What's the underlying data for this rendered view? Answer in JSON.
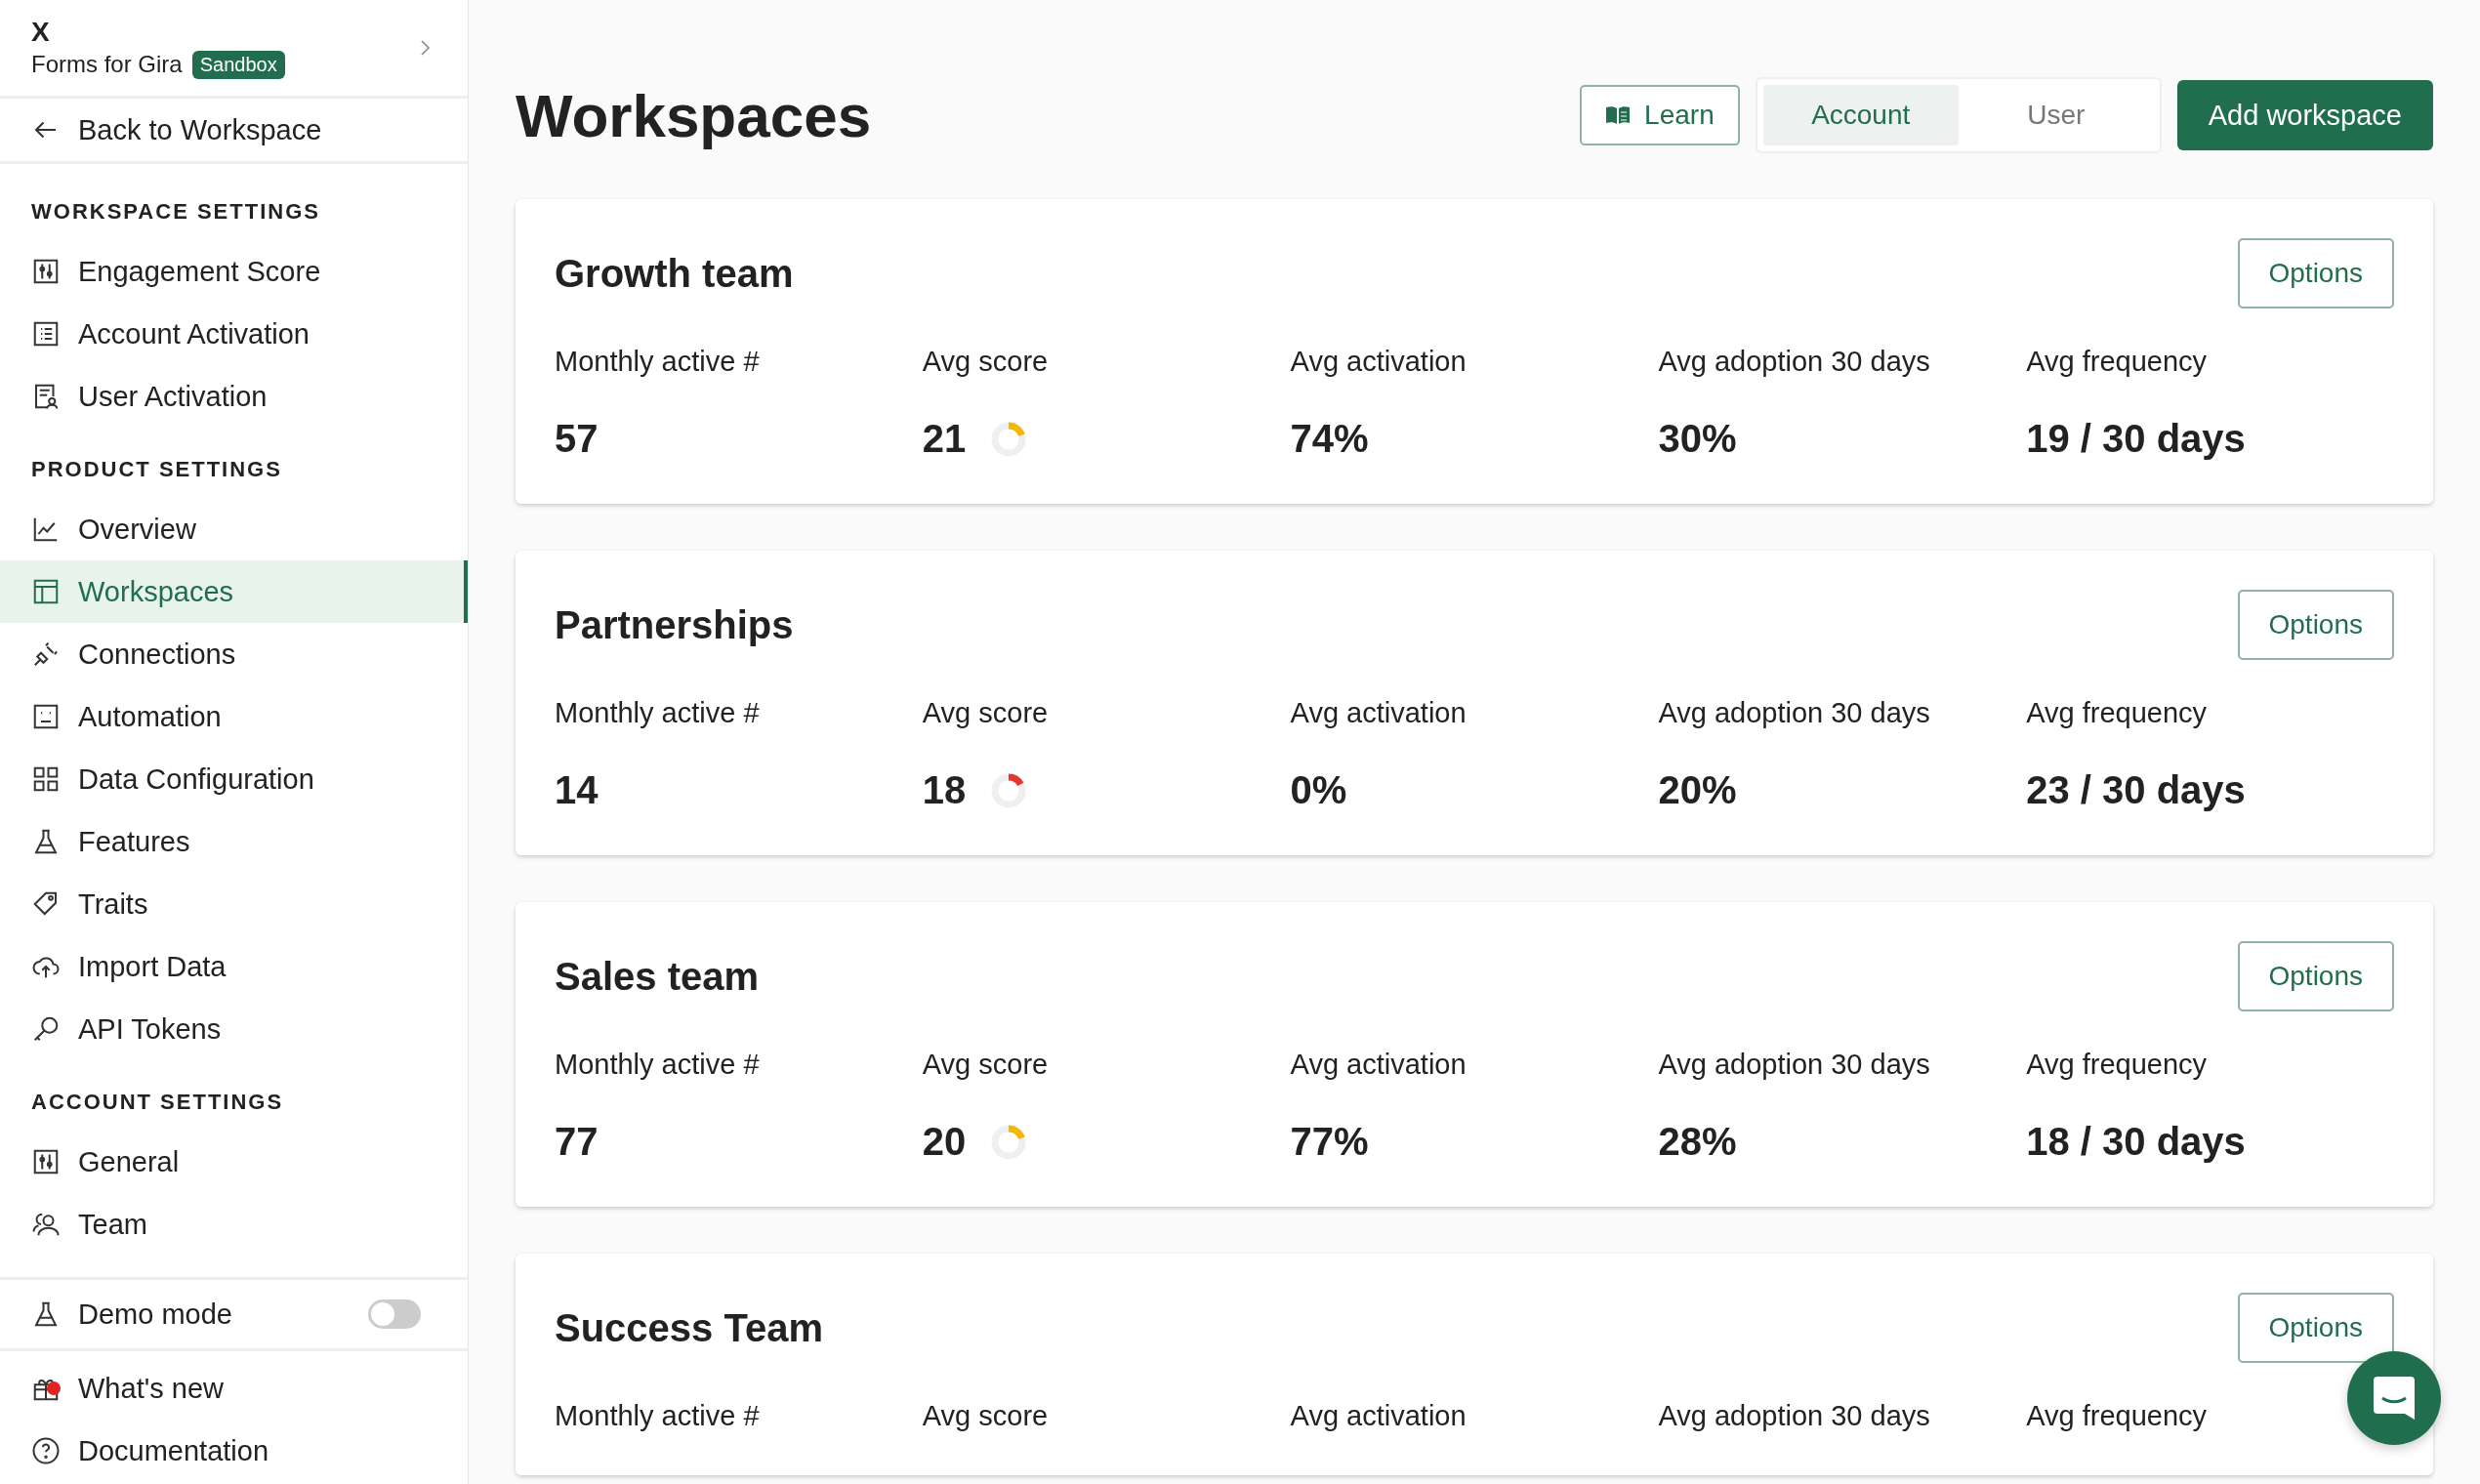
{
  "sidebar": {
    "brand": "X",
    "product": "Forms for Gira",
    "env_badge": "Sandbox",
    "back_link": "Back to Workspace",
    "sections": [
      {
        "heading": "WORKSPACE SETTINGS",
        "items": [
          {
            "label": "Engagement Score",
            "selected": false
          },
          {
            "label": "Account Activation",
            "selected": false
          },
          {
            "label": "User Activation",
            "selected": false
          }
        ]
      },
      {
        "heading": "PRODUCT SETTINGS",
        "items": [
          {
            "label": "Overview",
            "selected": false
          },
          {
            "label": "Workspaces",
            "selected": true
          },
          {
            "label": "Connections",
            "selected": false
          },
          {
            "label": "Automation",
            "selected": false
          },
          {
            "label": "Data Configuration",
            "selected": false
          },
          {
            "label": "Features",
            "selected": false
          },
          {
            "label": "Traits",
            "selected": false
          },
          {
            "label": "Import Data",
            "selected": false
          },
          {
            "label": "API Tokens",
            "selected": false
          }
        ]
      },
      {
        "heading": "ACCOUNT SETTINGS",
        "items": [
          {
            "label": "General",
            "selected": false
          },
          {
            "label": "Team",
            "selected": false
          }
        ]
      }
    ],
    "demo_mode": {
      "label": "Demo mode",
      "on": false
    },
    "footer_links": [
      {
        "label": "What's new",
        "unread": true
      },
      {
        "label": "Documentation",
        "unread": false
      }
    ]
  },
  "header": {
    "title": "Workspaces",
    "learn_button": "Learn",
    "view_tabs": [
      {
        "label": "Account",
        "selected": true
      },
      {
        "label": "User",
        "selected": false
      }
    ],
    "add_button": "Add workspace"
  },
  "workspaces": [
    {
      "name": "Growth team",
      "options_button": "Options",
      "metrics": [
        {
          "label": "Monthly active #",
          "value": "57"
        },
        {
          "label": "Avg score",
          "value": "21",
          "score_ring": {
            "level": 0.2,
            "color": "#f5b800"
          }
        },
        {
          "label": "Avg activation",
          "value": "74%"
        },
        {
          "label": "Avg adoption 30 days",
          "value": "30%"
        },
        {
          "label": "Avg frequency",
          "value": "19 / 30 days"
        }
      ]
    },
    {
      "name": "Partnerships",
      "options_button": "Options",
      "metrics": [
        {
          "label": "Monthly active #",
          "value": "14"
        },
        {
          "label": "Avg score",
          "value": "18",
          "score_ring": {
            "level": 0.17,
            "color": "#e8362b"
          }
        },
        {
          "label": "Avg activation",
          "value": "0%"
        },
        {
          "label": "Avg adoption 30 days",
          "value": "20%"
        },
        {
          "label": "Avg frequency",
          "value": "23 / 30 days"
        }
      ]
    },
    {
      "name": "Sales team",
      "options_button": "Options",
      "metrics": [
        {
          "label": "Monthly active #",
          "value": "77"
        },
        {
          "label": "Avg score",
          "value": "20",
          "score_ring": {
            "level": 0.2,
            "color": "#f5b800"
          }
        },
        {
          "label": "Avg activation",
          "value": "77%"
        },
        {
          "label": "Avg adoption 30 days",
          "value": "28%"
        },
        {
          "label": "Avg frequency",
          "value": "18 / 30 days"
        }
      ]
    },
    {
      "name": "Success Team",
      "options_button": "Options",
      "metrics": [
        {
          "label": "Monthly active #"
        },
        {
          "label": "Avg score"
        },
        {
          "label": "Avg activation"
        },
        {
          "label": "Avg adoption 30 days"
        },
        {
          "label": "Avg frequency"
        }
      ]
    }
  ]
}
